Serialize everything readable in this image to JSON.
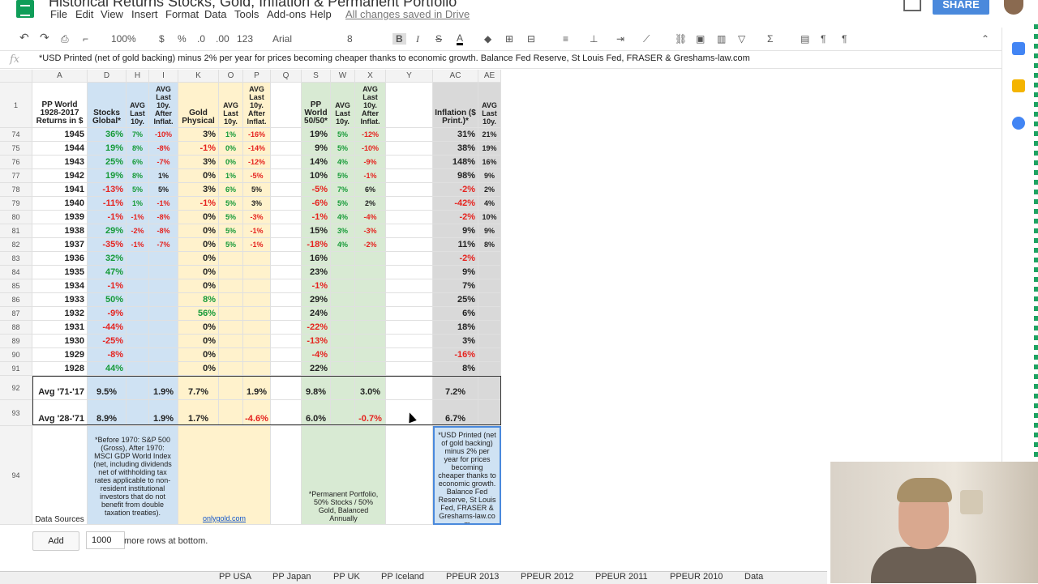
{
  "app": {
    "doc_title": "Historical Returns Stocks, Gold, Inflation & Permanent Portfolio",
    "save_status": "All changes saved in Drive",
    "share_label": "SHARE",
    "menus": [
      "File",
      "Edit",
      "View",
      "Insert",
      "Format",
      "Data",
      "Tools",
      "Add-ons",
      "Help"
    ]
  },
  "toolbar": {
    "zoom": "100%",
    "currency": "$",
    "percent": "%",
    "dec_less": ".0",
    "dec_more": ".00",
    "format_more": "123",
    "font": "Arial",
    "font_size": "8",
    "bold": "B",
    "italic": "I",
    "strike": "S",
    "text_color": "A"
  },
  "formula_bar": {
    "fx": "fx",
    "content": "*USD Printed (net of gold backing) minus 2% per year for prices becoming cheaper thanks to economic growth. Balance Fed Reserve, St Louis Fed, FRASER & Greshams-law.com"
  },
  "columns": [
    "A",
    "D",
    "H",
    "I",
    "K",
    "O",
    "P",
    "Q",
    "S",
    "W",
    "X",
    "Y",
    "AC",
    "AE"
  ],
  "header": {
    "row_number": "1",
    "a": "PP World 1928-2017 Returns in $",
    "d": "Stocks Global*",
    "h": "AVG Last 10y.",
    "i": "AVG Last 10y. After Inflat.",
    "k": "Gold Physical",
    "o": "AVG Last 10y.",
    "p": "AVG Last 10y. After Inflat.",
    "s": "PP World 50/50*",
    "w": "AVG Last 10y.",
    "x": "AVG Last 10y. After Inflat.",
    "ac": "Inflation ($ Print.)*",
    "ae": "AVG Last 10y."
  },
  "rows": [
    {
      "n": "74",
      "year": "1945",
      "d": "36%",
      "h": "7%",
      "i": "-10%",
      "k": "3%",
      "o": "1%",
      "p": "-16%",
      "s": "19%",
      "w": "5%",
      "x": "-12%",
      "ac": "31%",
      "ae": "21%"
    },
    {
      "n": "75",
      "year": "1944",
      "d": "19%",
      "h": "8%",
      "i": "-8%",
      "k": "-1%",
      "o": "0%",
      "p": "-14%",
      "s": "9%",
      "w": "5%",
      "x": "-10%",
      "ac": "38%",
      "ae": "19%"
    },
    {
      "n": "76",
      "year": "1943",
      "d": "25%",
      "h": "6%",
      "i": "-7%",
      "k": "3%",
      "o": "0%",
      "p": "-12%",
      "s": "14%",
      "w": "4%",
      "x": "-9%",
      "ac": "148%",
      "ae": "16%"
    },
    {
      "n": "77",
      "year": "1942",
      "d": "19%",
      "h": "8%",
      "i": "1%",
      "k": "0%",
      "o": "1%",
      "p": "-5%",
      "s": "10%",
      "w": "5%",
      "x": "-1%",
      "ac": "98%",
      "ae": "9%"
    },
    {
      "n": "78",
      "year": "1941",
      "d": "-13%",
      "h": "5%",
      "i": "5%",
      "k": "3%",
      "o": "6%",
      "p": "5%",
      "s": "-5%",
      "w": "7%",
      "x": "6%",
      "ac": "-2%",
      "ae": "2%"
    },
    {
      "n": "79",
      "year": "1940",
      "d": "-11%",
      "h": "1%",
      "i": "-1%",
      "k": "-1%",
      "o": "5%",
      "p": "3%",
      "s": "-6%",
      "w": "5%",
      "x": "2%",
      "ac": "-42%",
      "ae": "4%"
    },
    {
      "n": "80",
      "year": "1939",
      "d": "-1%",
      "h": "-1%",
      "i": "-8%",
      "k": "0%",
      "o": "5%",
      "p": "-3%",
      "s": "-1%",
      "w": "4%",
      "x": "-4%",
      "ac": "-2%",
      "ae": "10%"
    },
    {
      "n": "81",
      "year": "1938",
      "d": "29%",
      "h": "-2%",
      "i": "-8%",
      "k": "0%",
      "o": "5%",
      "p": "-1%",
      "s": "15%",
      "w": "3%",
      "x": "-3%",
      "ac": "9%",
      "ae": "9%"
    },
    {
      "n": "82",
      "year": "1937",
      "d": "-35%",
      "h": "-1%",
      "i": "-7%",
      "k": "0%",
      "o": "5%",
      "p": "-1%",
      "s": "-18%",
      "w": "4%",
      "x": "-2%",
      "ac": "11%",
      "ae": "8%"
    },
    {
      "n": "83",
      "year": "1936",
      "d": "32%",
      "h": "",
      "i": "",
      "k": "0%",
      "o": "",
      "p": "",
      "s": "16%",
      "w": "",
      "x": "",
      "ac": "-2%",
      "ae": ""
    },
    {
      "n": "84",
      "year": "1935",
      "d": "47%",
      "h": "",
      "i": "",
      "k": "0%",
      "o": "",
      "p": "",
      "s": "23%",
      "w": "",
      "x": "",
      "ac": "9%",
      "ae": ""
    },
    {
      "n": "85",
      "year": "1934",
      "d": "-1%",
      "h": "",
      "i": "",
      "k": "0%",
      "o": "",
      "p": "",
      "s": "-1%",
      "w": "",
      "x": "",
      "ac": "7%",
      "ae": ""
    },
    {
      "n": "86",
      "year": "1933",
      "d": "50%",
      "h": "",
      "i": "",
      "k": "8%",
      "o": "",
      "p": "",
      "s": "29%",
      "w": "",
      "x": "",
      "ac": "25%",
      "ae": ""
    },
    {
      "n": "87",
      "year": "1932",
      "d": "-9%",
      "h": "",
      "i": "",
      "k": "56%",
      "o": "",
      "p": "",
      "s": "24%",
      "w": "",
      "x": "",
      "ac": "6%",
      "ae": ""
    },
    {
      "n": "88",
      "year": "1931",
      "d": "-44%",
      "h": "",
      "i": "",
      "k": "0%",
      "o": "",
      "p": "",
      "s": "-22%",
      "w": "",
      "x": "",
      "ac": "18%",
      "ae": ""
    },
    {
      "n": "89",
      "year": "1930",
      "d": "-25%",
      "h": "",
      "i": "",
      "k": "0%",
      "o": "",
      "p": "",
      "s": "-13%",
      "w": "",
      "x": "",
      "ac": "3%",
      "ae": ""
    },
    {
      "n": "90",
      "year": "1929",
      "d": "-8%",
      "h": "",
      "i": "",
      "k": "0%",
      "o": "",
      "p": "",
      "s": "-4%",
      "w": "",
      "x": "",
      "ac": "-16%",
      "ae": ""
    },
    {
      "n": "91",
      "year": "1928",
      "d": "44%",
      "h": "",
      "i": "",
      "k": "0%",
      "o": "",
      "p": "",
      "s": "22%",
      "w": "",
      "x": "",
      "ac": "8%",
      "ae": ""
    }
  ],
  "averages": [
    {
      "n": "92",
      "label": "Avg '71-'17",
      "d": "9.5%",
      "i": "1.9%",
      "k": "7.7%",
      "p": "1.9%",
      "s": "9.8%",
      "x": "3.0%",
      "ac": "7.2%"
    },
    {
      "n": "93",
      "label": "Avg '28-'71",
      "d": "8.9%",
      "i": "1.9%",
      "k": "1.7%",
      "p": "-4.6%",
      "s": "6.0%",
      "x": "-0.7%",
      "ac": "6.7%"
    }
  ],
  "sources": {
    "n": "94",
    "label": "Data Sources",
    "stocks_note": "*Before 1970: S&P 500 (Gross), After 1970: MSCI GDP World Index (net, including dividends net of withholding tax rates applicable to non-resident institutional investors that do not benefit from double taxation treaties).",
    "gold_link": "onlygold.com",
    "pp_note": "*Permanent Portfolio, 50% Stocks / 50% Gold, Balanced Annually",
    "inflation_note": "*USD Printed (net of gold backing) minus 2% per year for prices becoming cheaper thanks to economic growth. Balance Fed Reserve, St Louis Fed, FRASER & Greshams-law.co m"
  },
  "footer": {
    "add_label": "Add",
    "rows_value": "1000",
    "rows_text": "more rows at bottom."
  },
  "sheet_tabs": [
    "PP USA",
    "PP Japan",
    "PP UK",
    "PP Iceland",
    "PPEUR 2013",
    "PPEUR 2012",
    "PPEUR 2011",
    "PPEUR 2010",
    "Data"
  ],
  "colors": {
    "green_fill": "#d8ead3",
    "blue_fill": "#cfe2f3",
    "yellow_fill": "#fff2cc",
    "grey_fill": "#d9d9d9",
    "positive": "#159a37",
    "negative": "#e5231f",
    "share_blue": "#4a89dc",
    "sheets_green": "#0f9d58"
  }
}
